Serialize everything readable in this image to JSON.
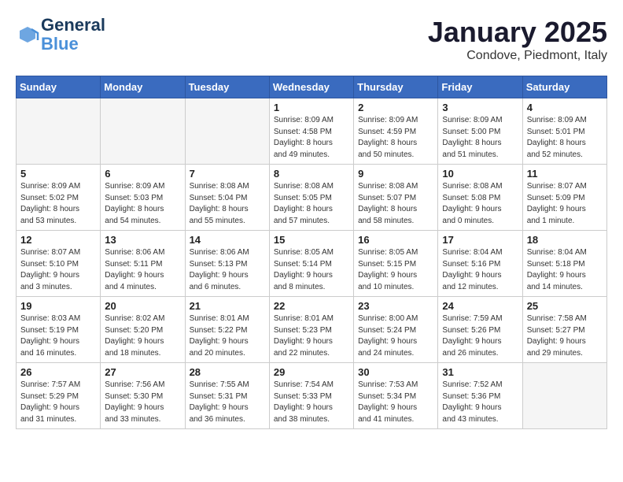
{
  "header": {
    "logo_line1": "General",
    "logo_line2": "Blue",
    "month": "January 2025",
    "location": "Condove, Piedmont, Italy"
  },
  "weekdays": [
    "Sunday",
    "Monday",
    "Tuesday",
    "Wednesday",
    "Thursday",
    "Friday",
    "Saturday"
  ],
  "weeks": [
    [
      {
        "day": "",
        "info": ""
      },
      {
        "day": "",
        "info": ""
      },
      {
        "day": "",
        "info": ""
      },
      {
        "day": "1",
        "info": "Sunrise: 8:09 AM\nSunset: 4:58 PM\nDaylight: 8 hours\nand 49 minutes."
      },
      {
        "day": "2",
        "info": "Sunrise: 8:09 AM\nSunset: 4:59 PM\nDaylight: 8 hours\nand 50 minutes."
      },
      {
        "day": "3",
        "info": "Sunrise: 8:09 AM\nSunset: 5:00 PM\nDaylight: 8 hours\nand 51 minutes."
      },
      {
        "day": "4",
        "info": "Sunrise: 8:09 AM\nSunset: 5:01 PM\nDaylight: 8 hours\nand 52 minutes."
      }
    ],
    [
      {
        "day": "5",
        "info": "Sunrise: 8:09 AM\nSunset: 5:02 PM\nDaylight: 8 hours\nand 53 minutes."
      },
      {
        "day": "6",
        "info": "Sunrise: 8:09 AM\nSunset: 5:03 PM\nDaylight: 8 hours\nand 54 minutes."
      },
      {
        "day": "7",
        "info": "Sunrise: 8:08 AM\nSunset: 5:04 PM\nDaylight: 8 hours\nand 55 minutes."
      },
      {
        "day": "8",
        "info": "Sunrise: 8:08 AM\nSunset: 5:05 PM\nDaylight: 8 hours\nand 57 minutes."
      },
      {
        "day": "9",
        "info": "Sunrise: 8:08 AM\nSunset: 5:07 PM\nDaylight: 8 hours\nand 58 minutes."
      },
      {
        "day": "10",
        "info": "Sunrise: 8:08 AM\nSunset: 5:08 PM\nDaylight: 9 hours\nand 0 minutes."
      },
      {
        "day": "11",
        "info": "Sunrise: 8:07 AM\nSunset: 5:09 PM\nDaylight: 9 hours\nand 1 minute."
      }
    ],
    [
      {
        "day": "12",
        "info": "Sunrise: 8:07 AM\nSunset: 5:10 PM\nDaylight: 9 hours\nand 3 minutes."
      },
      {
        "day": "13",
        "info": "Sunrise: 8:06 AM\nSunset: 5:11 PM\nDaylight: 9 hours\nand 4 minutes."
      },
      {
        "day": "14",
        "info": "Sunrise: 8:06 AM\nSunset: 5:13 PM\nDaylight: 9 hours\nand 6 minutes."
      },
      {
        "day": "15",
        "info": "Sunrise: 8:05 AM\nSunset: 5:14 PM\nDaylight: 9 hours\nand 8 minutes."
      },
      {
        "day": "16",
        "info": "Sunrise: 8:05 AM\nSunset: 5:15 PM\nDaylight: 9 hours\nand 10 minutes."
      },
      {
        "day": "17",
        "info": "Sunrise: 8:04 AM\nSunset: 5:16 PM\nDaylight: 9 hours\nand 12 minutes."
      },
      {
        "day": "18",
        "info": "Sunrise: 8:04 AM\nSunset: 5:18 PM\nDaylight: 9 hours\nand 14 minutes."
      }
    ],
    [
      {
        "day": "19",
        "info": "Sunrise: 8:03 AM\nSunset: 5:19 PM\nDaylight: 9 hours\nand 16 minutes."
      },
      {
        "day": "20",
        "info": "Sunrise: 8:02 AM\nSunset: 5:20 PM\nDaylight: 9 hours\nand 18 minutes."
      },
      {
        "day": "21",
        "info": "Sunrise: 8:01 AM\nSunset: 5:22 PM\nDaylight: 9 hours\nand 20 minutes."
      },
      {
        "day": "22",
        "info": "Sunrise: 8:01 AM\nSunset: 5:23 PM\nDaylight: 9 hours\nand 22 minutes."
      },
      {
        "day": "23",
        "info": "Sunrise: 8:00 AM\nSunset: 5:24 PM\nDaylight: 9 hours\nand 24 minutes."
      },
      {
        "day": "24",
        "info": "Sunrise: 7:59 AM\nSunset: 5:26 PM\nDaylight: 9 hours\nand 26 minutes."
      },
      {
        "day": "25",
        "info": "Sunrise: 7:58 AM\nSunset: 5:27 PM\nDaylight: 9 hours\nand 29 minutes."
      }
    ],
    [
      {
        "day": "26",
        "info": "Sunrise: 7:57 AM\nSunset: 5:29 PM\nDaylight: 9 hours\nand 31 minutes."
      },
      {
        "day": "27",
        "info": "Sunrise: 7:56 AM\nSunset: 5:30 PM\nDaylight: 9 hours\nand 33 minutes."
      },
      {
        "day": "28",
        "info": "Sunrise: 7:55 AM\nSunset: 5:31 PM\nDaylight: 9 hours\nand 36 minutes."
      },
      {
        "day": "29",
        "info": "Sunrise: 7:54 AM\nSunset: 5:33 PM\nDaylight: 9 hours\nand 38 minutes."
      },
      {
        "day": "30",
        "info": "Sunrise: 7:53 AM\nSunset: 5:34 PM\nDaylight: 9 hours\nand 41 minutes."
      },
      {
        "day": "31",
        "info": "Sunrise: 7:52 AM\nSunset: 5:36 PM\nDaylight: 9 hours\nand 43 minutes."
      },
      {
        "day": "",
        "info": ""
      }
    ]
  ]
}
